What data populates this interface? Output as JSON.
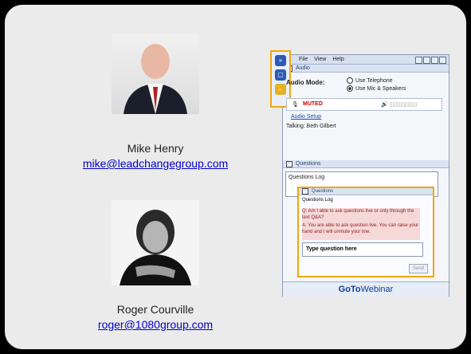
{
  "presenters": [
    {
      "name": "Mike Henry",
      "email": "mike@leadchangegroup.com"
    },
    {
      "name": "Roger Courville",
      "email": "roger@1080group.com"
    }
  ],
  "webinar": {
    "menu": [
      "File",
      "View",
      "Help"
    ],
    "audio_header": "Audio",
    "audio_mode_label": "Audio Mode:",
    "option_telephone": "Use Telephone",
    "option_mic": "Use Mic & Speakers",
    "muted": "MUTED",
    "audio_setup": "Audio Setup",
    "talking": "Talking: Beth Gilbert",
    "questions_header": "Questions",
    "questions_log": "Questions Log",
    "popup": {
      "header": "Questions",
      "log": "Questions Log",
      "q": "Q: Am I able to ask questions live or only through the text Q&A?",
      "a": "A: You are able to ask question live. You can raise your hand and I will unmute your line.",
      "input_placeholder": "Type question here",
      "send": "Send"
    },
    "logo_bold": "GoTo",
    "logo_rest": "Webinar"
  },
  "colors": {
    "accent": "#f2a60c",
    "link": "#0000cc"
  }
}
